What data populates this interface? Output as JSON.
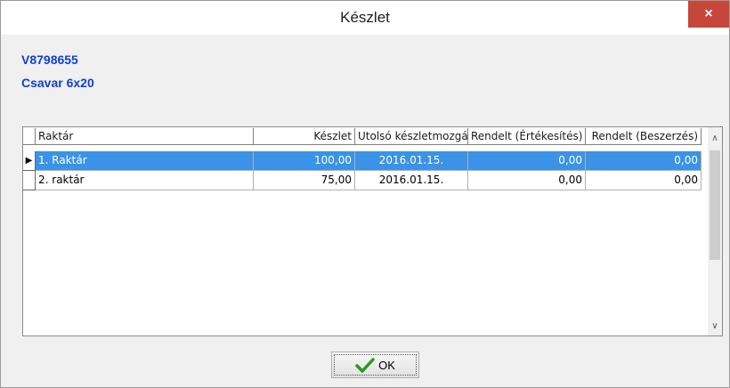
{
  "window": {
    "title": "Készlet",
    "close_glyph": "×"
  },
  "item": {
    "code": "V8798655",
    "name": "Csavar 6x20"
  },
  "grid": {
    "columns": [
      "Raktár",
      "Készlet",
      "Utolsó készletmozgás",
      "Rendelt (Értékesítés)",
      "Rendelt (Beszerzés)"
    ],
    "rows": [
      {
        "raktar": "1. Raktár",
        "keszlet": "100,00",
        "utolso": "2016.01.15.",
        "rendelt_ert": "0,00",
        "rendelt_besz": "0,00",
        "selected": true
      },
      {
        "raktar": "2. raktár",
        "keszlet": "75,00",
        "utolso": "2016.01.15.",
        "rendelt_ert": "0,00",
        "rendelt_besz": "0,00",
        "selected": false
      }
    ],
    "row_indicator_glyph": "▶",
    "scroll_up_glyph": "∧",
    "scroll_down_glyph": "∨"
  },
  "ok_button": {
    "label": "OK",
    "icon": "checkmark-icon",
    "icon_color": "#2a9a1a"
  },
  "colors": {
    "selection": "#3a93e6",
    "label_blue": "#1040d0",
    "close_red": "#c7463a"
  }
}
